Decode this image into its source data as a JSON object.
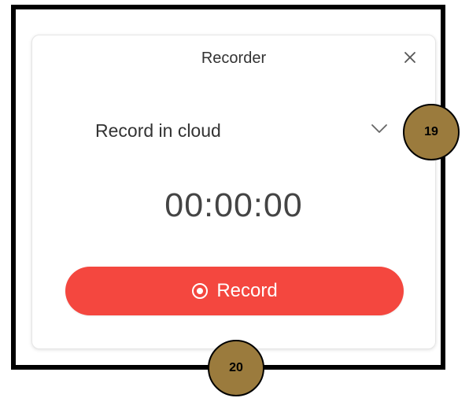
{
  "dialog": {
    "title": "Recorder",
    "close_icon": "close-icon",
    "mode": {
      "selected": "Record in cloud",
      "icon": "chevron-down-icon"
    },
    "timer": "00:00:00",
    "record_button": {
      "label": "Record",
      "icon": "record-icon",
      "color": "#f4473f"
    }
  },
  "callouts": {
    "first": "19",
    "second": "20",
    "color": "#9b7b3d"
  }
}
